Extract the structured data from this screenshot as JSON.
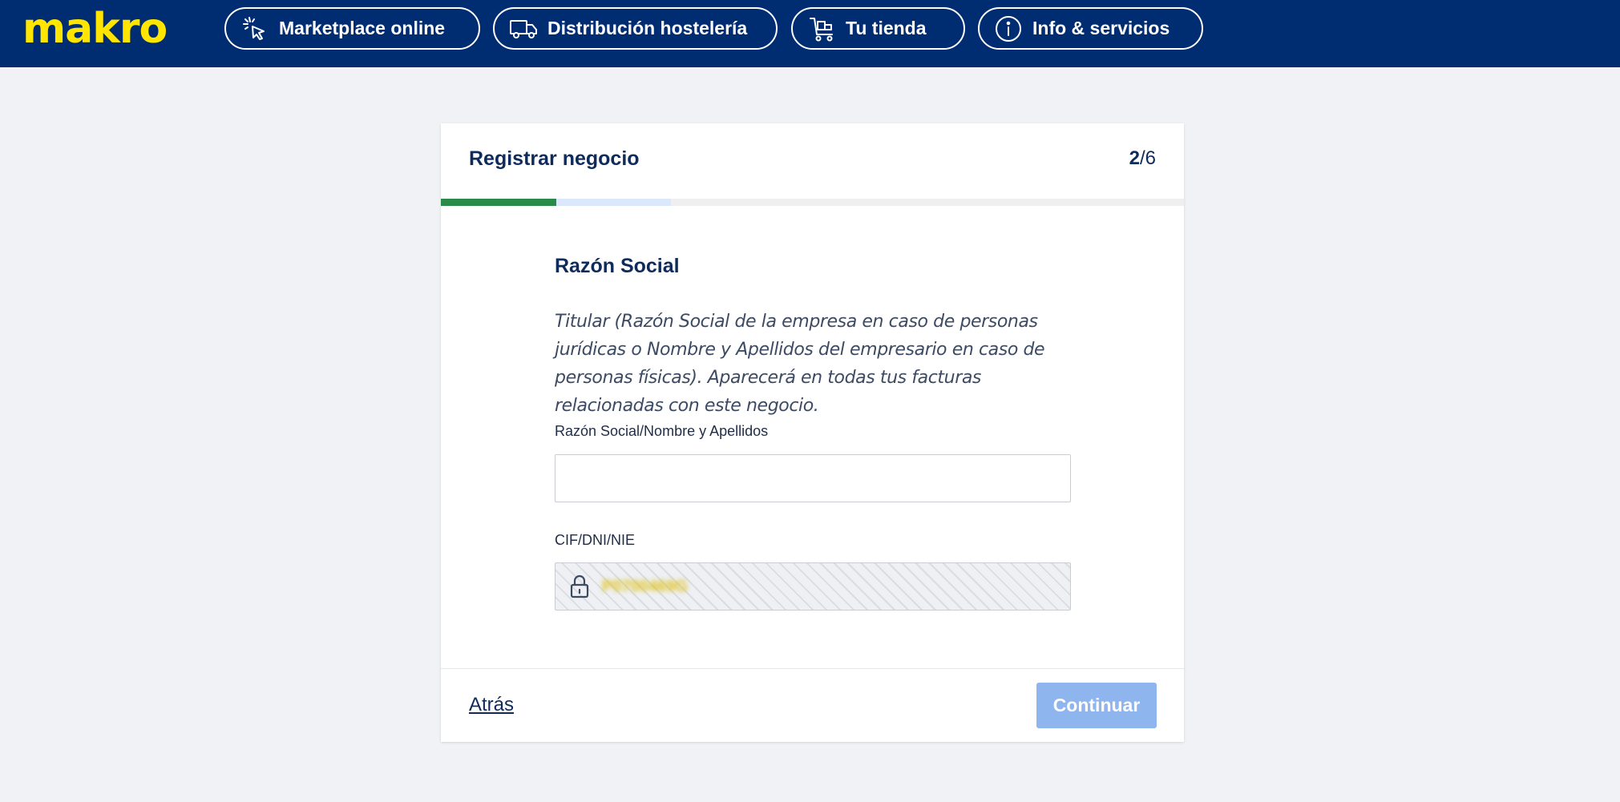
{
  "header": {
    "logo_text": "makro",
    "nav": [
      {
        "label": "Marketplace online",
        "icon": "cursor-click-icon"
      },
      {
        "label": "Distribución hostelería",
        "icon": "truck-icon"
      },
      {
        "label": "Tu tienda",
        "icon": "cart-icon"
      },
      {
        "label": "Info & servicios",
        "icon": "info-icon"
      }
    ],
    "colors": {
      "bar": "#002d72",
      "logo": "#ffe500"
    }
  },
  "card": {
    "title": "Registrar negocio",
    "step_current": "2",
    "step_total": "/6",
    "progress": {
      "done_fraction": 0.1667,
      "current_fraction": 0.3333
    }
  },
  "form": {
    "section_title": "Razón Social",
    "description": "Titular (Razón Social de la empresa en caso de personas jurídicas o Nombre y Apellidos del empresario en caso de personas físicas). Aparecerá en todas tus facturas relacionadas con este negocio.",
    "razon_label": "Razón Social/Nombre y Apellidos",
    "razon_value": "",
    "cif_label": "CIF/DNI/NIE",
    "cif_value": "P0700469G",
    "cif_icon": "lock-icon"
  },
  "footer": {
    "back_label": "Atrás",
    "continue_label": "Continuar",
    "continue_color": "#8fb5ef"
  }
}
